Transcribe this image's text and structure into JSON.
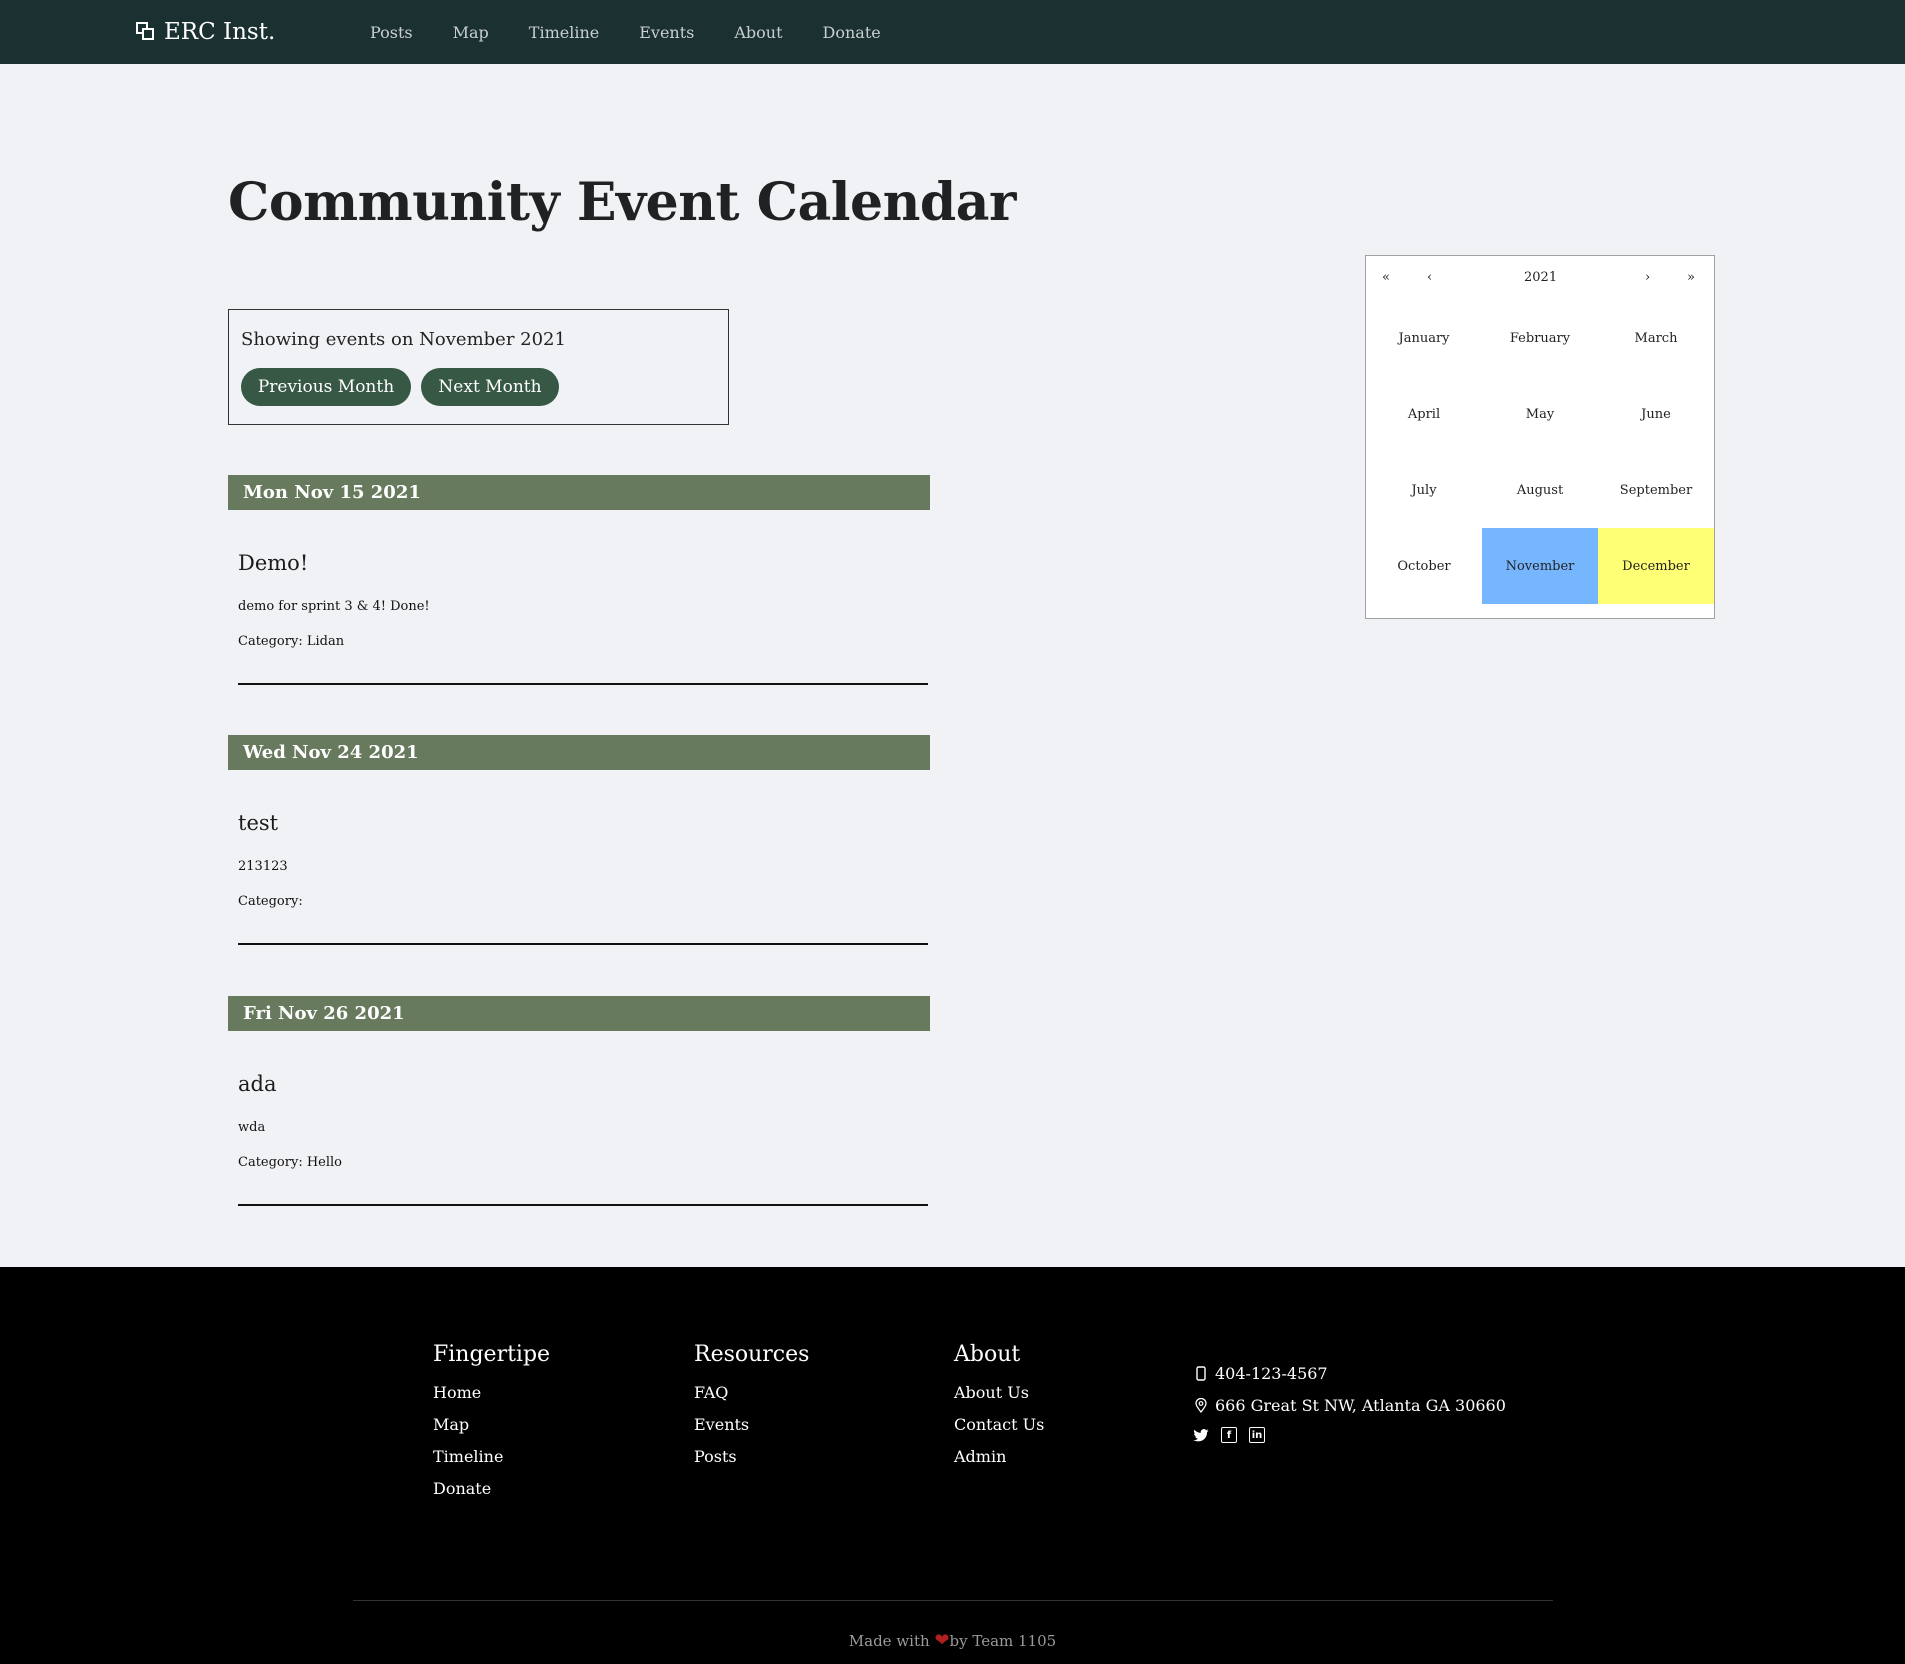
{
  "navbar": {
    "brand": "ERC Inst.",
    "links": [
      "Posts",
      "Map",
      "Timeline",
      "Events",
      "About",
      "Donate"
    ]
  },
  "main": {
    "title": "Community Event Calendar",
    "showing_text": "Showing events on November 2021",
    "prev_label": "Previous Month",
    "next_label": "Next Month",
    "events": [
      {
        "date": "Mon Nov 15 2021",
        "title": "Demo!",
        "description": "demo for sprint 3 & 4! Done!",
        "category": "Category: Lidan"
      },
      {
        "date": "Wed Nov 24 2021",
        "title": "test",
        "description": "213123",
        "category": "Category:"
      },
      {
        "date": "Fri Nov 26 2021",
        "title": "ada",
        "description": "wda",
        "category": "Category: Hello"
      }
    ]
  },
  "picker": {
    "prev_decade": "«",
    "prev_year": "‹",
    "year": "2021",
    "next_year": "›",
    "next_decade": "»",
    "months": [
      "January",
      "February",
      "March",
      "April",
      "May",
      "June",
      "July",
      "August",
      "September",
      "October",
      "November",
      "December"
    ],
    "selected_month": "November",
    "current_month": "December",
    "selected_color": "#76b6fe",
    "current_color": "#ffff76"
  },
  "footer": {
    "col1": {
      "heading": "Fingertipe",
      "items": [
        "Home",
        "Map",
        "Timeline",
        "Donate"
      ]
    },
    "col2": {
      "heading": "Resources",
      "items": [
        "FAQ",
        "Events",
        "Posts"
      ]
    },
    "col3": {
      "heading": "About",
      "items": [
        "About Us",
        "Contact Us",
        "Admin"
      ]
    },
    "phone": "404-123-4567",
    "address": "666 Great St NW, Atlanta GA 30660",
    "social_icons": [
      "twitter-icon",
      "facebook-icon",
      "linkedin-icon"
    ],
    "made_with": "Made with",
    "by_team": "by Team 1105"
  },
  "colors": {
    "navbar": "#1b3031",
    "button": "#365844",
    "date_bar": "#687a5e",
    "footer": "#000000"
  }
}
